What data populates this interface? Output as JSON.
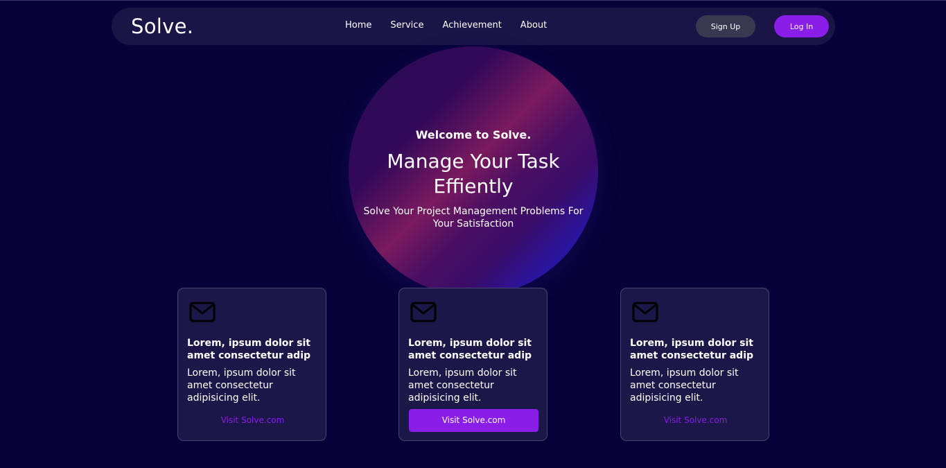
{
  "nav": {
    "logo": "Solve.",
    "links": [
      "Home",
      "Service",
      "Achievement",
      "About"
    ],
    "signup_label": "Sign Up",
    "login_label": "Log In"
  },
  "hero": {
    "welcome": "Welcome to Solve.",
    "title": "Manage Your Task Effiently",
    "subtitle": "Solve Your Project Management Problems For Your Satisfaction"
  },
  "cards": [
    {
      "icon": "envelope-icon",
      "title": "Lorem, ipsum dolor sit amet consectetur adip",
      "body": "Lorem, ipsum dolor sit amet consectetur adipisicing elit.",
      "link": "Visit Solve.com",
      "active": false
    },
    {
      "icon": "envelope-icon",
      "title": "Lorem, ipsum dolor sit amet consectetur adip",
      "body": "Lorem, ipsum dolor sit amet consectetur adipisicing elit.",
      "link": "Visit Solve.com",
      "active": true
    },
    {
      "icon": "envelope-icon",
      "title": "Lorem, ipsum dolor sit amet consectetur adip",
      "body": "Lorem, ipsum dolor sit amet consectetur adipisicing elit.",
      "link": "Visit Solve.com",
      "active": false
    }
  ],
  "colors": {
    "background": "#07033a",
    "navbar": "#1a1447",
    "accent": "#8a1de8",
    "card": "#1b1748",
    "signup_button": "#3a3750"
  }
}
